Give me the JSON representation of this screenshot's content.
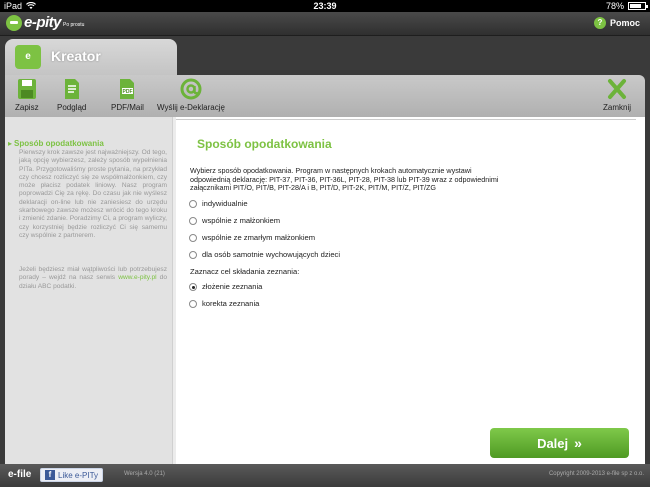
{
  "status_bar": {
    "device": "iPad",
    "time": "23:39",
    "battery": "78%",
    "battery_level": 0.78
  },
  "app": {
    "brand": "e-pity",
    "tagline": "Po prostu",
    "help_label": "Pomoc"
  },
  "tab": {
    "label": "Kreator"
  },
  "toolbar": {
    "save": "Zapisz",
    "preview": "Podgląd",
    "pdf_mail": "PDF/Mail",
    "send": "Wyślij e-Deklarację",
    "close": "Zamknij"
  },
  "sidebar": {
    "title": "Sposób opodatkowania",
    "paragraph1": "Pierwszy krok zawsze jest najważniejszy. Od tego, jaką opcję wybierzesz, zależy sposób wypełnienia PITa. Przygotowaliśmy proste pytania, na przykład czy chcesz rozliczyć się ze współmałżonkiem, czy może płacisz podatek liniowy. Nasz program poprowadzi Cię za rękę. Do czasu jak nie wyślesz deklaracji on-line lub nie zaniesiesz do urzędu skarbowego zawsze możesz wrócić do tego kroku i zmienić zdanie. Poradzimy Ci, a program wyliczy, czy korzystniej będzie rozliczyć Ci się samemu czy wspólnie z partnerem.",
    "paragraph2_a": "Jeżeli będziesz miał wątpliwości lub potrzebujesz porady – wejdź na nasz serwis ",
    "paragraph2_link": "www.e-pity.pl",
    "paragraph2_b": " do działu ABC podatki."
  },
  "main": {
    "title": "Sposób opodatkowania",
    "intro": "Wybierz sposób opodatkowania. Program w następnych krokach automatycznie wystawi odpowiednią deklarację: PIT-37, PIT-36, PIT-36L, PIT-28, PIT-38 lub PIT-39 wraz z odpowiednimi załącznikami PIT/O, PIT/B, PIT-28/A i B, PIT/D, PIT-2K, PIT/M, PIT/Z, PIT/ZG",
    "options": [
      {
        "label": "indywidualnie",
        "checked": false
      },
      {
        "label": "wspólnie z małżonkiem",
        "checked": false
      },
      {
        "label": "wspólnie ze zmarłym małżonkiem",
        "checked": false
      },
      {
        "label": "dla osób samotnie wychowujących dzieci",
        "checked": false
      }
    ],
    "purpose_question": "Zaznacz cel składania zeznania:",
    "purpose_options": [
      {
        "label": "złożenie zeznania",
        "checked": true
      },
      {
        "label": "korekta zeznania",
        "checked": false
      }
    ],
    "next_label": "Dalej"
  },
  "footer": {
    "brand": "e-file",
    "like_label": "Like e-PITy",
    "version": "Wersja 4.0 (21)",
    "copyright": "Copyright 2009-2013 e-file sp z o.o."
  },
  "colors": {
    "brand_green": "#7dc243",
    "button_green": "#5aa82b"
  }
}
